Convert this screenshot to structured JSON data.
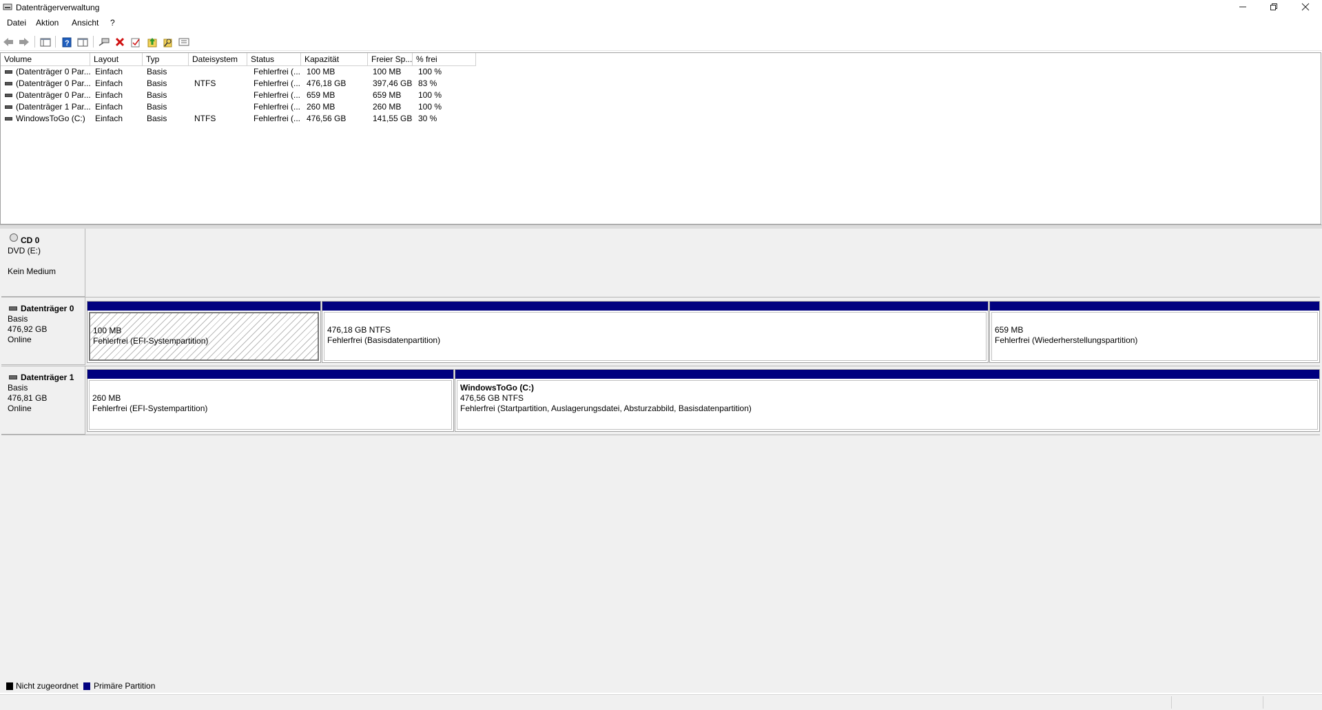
{
  "window": {
    "title": "Datenträgerverwaltung",
    "controls": [
      "minimize",
      "restore",
      "close"
    ]
  },
  "menu": [
    "Datei",
    "Aktion",
    "Ansicht",
    "?"
  ],
  "toolbar": [
    "back-arrow",
    "forward-arrow",
    "console-tree",
    "help",
    "properties",
    "connect",
    "delete",
    "check",
    "up-arrow",
    "search",
    "view"
  ],
  "table": {
    "columns": [
      "Volume",
      "Layout",
      "Typ",
      "Dateisystem",
      "Status",
      "Kapazität",
      "Freier Sp...",
      "% frei"
    ],
    "rows": [
      [
        "(Datenträger 0 Par...",
        "Einfach",
        "Basis",
        "",
        "Fehlerfrei (...",
        "100 MB",
        "100 MB",
        "100 %"
      ],
      [
        "(Datenträger 0 Par...",
        "Einfach",
        "Basis",
        "NTFS",
        "Fehlerfrei (...",
        "476,18 GB",
        "397,46 GB",
        "83 %"
      ],
      [
        "(Datenträger 0 Par...",
        "Einfach",
        "Basis",
        "",
        "Fehlerfrei (...",
        "659 MB",
        "659 MB",
        "100 %"
      ],
      [
        "(Datenträger 1 Par...",
        "Einfach",
        "Basis",
        "",
        "Fehlerfrei (...",
        "260 MB",
        "260 MB",
        "100 %"
      ],
      [
        "WindowsToGo (C:)",
        "Einfach",
        "Basis",
        "NTFS",
        "Fehlerfrei (...",
        "476,56 GB",
        "141,55 GB",
        "30 %"
      ]
    ]
  },
  "disks": {
    "cd0": {
      "name": "CD 0",
      "line1": "DVD (E:)",
      "line2": "Kein Medium"
    },
    "disk0": {
      "name": "Datenträger 0",
      "type": "Basis",
      "size": "476,92 GB",
      "state": "Online",
      "partitions": [
        {
          "line1": "100 MB",
          "line2": "Fehlerfrei (EFI-Systempartition)"
        },
        {
          "line1": "476,18 GB NTFS",
          "line2": "Fehlerfrei (Basisdatenpartition)"
        },
        {
          "line1": "659 MB",
          "line2": "Fehlerfrei (Wiederherstellungspartition)"
        }
      ]
    },
    "disk1": {
      "name": "Datenträger 1",
      "type": "Basis",
      "size": "476,81 GB",
      "state": "Online",
      "partitions": [
        {
          "line1": "260 MB",
          "line2": "Fehlerfrei (EFI-Systempartition)"
        },
        {
          "title": "WindowsToGo  (C:)",
          "line1": "476,56 GB NTFS",
          "line2": "Fehlerfrei (Startpartition, Auslagerungsdatei, Absturzabbild, Basisdatenpartition)"
        }
      ]
    }
  },
  "legend": [
    {
      "label": "Nicht zugeordnet",
      "color": "#000000"
    },
    {
      "label": "Primäre Partition",
      "color": "#00007f"
    }
  ]
}
